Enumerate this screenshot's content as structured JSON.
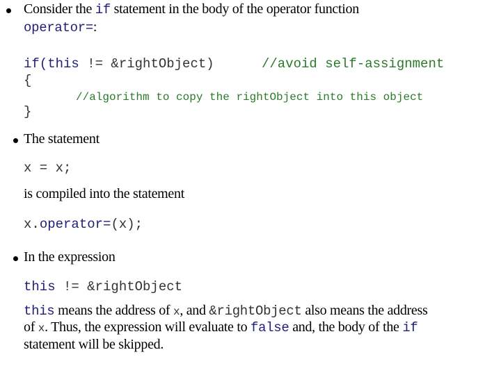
{
  "bullets": [
    {
      "intro_prefix": "Consider the ",
      "intro_kw": "if",
      "intro_suffix": " statement in the body of the operator function",
      "intro_line2_kw": "operator=",
      "intro_line2_suffix": ":",
      "code": {
        "line1_kw": "if(this",
        "line1_rest": " != &rightObject)",
        "line1_comment": "//avoid self-assignment",
        "open_brace": "{",
        "body_comment": "//algorithm to copy the rightObject into this object",
        "close_brace": "}"
      }
    },
    {
      "intro": "The statement",
      "code1": "x = x;",
      "middle": "is compiled into the statement",
      "code2_prefix": "x.",
      "code2_kw": "operator=",
      "code2_suffix": "(x);"
    },
    {
      "intro": "In the expression",
      "code_kw": "this",
      "code_rest": " != &rightObject",
      "explain": {
        "l1_kw": "this",
        "l1_a": " means the address of ",
        "l1_x": "x",
        "l1_b": ", and ",
        "l1_ref": "&rightObject",
        "l1_c": " also means the address",
        "l2_a": "of ",
        "l2_x": "x",
        "l2_b": ". Thus, the expression will evaluate to ",
        "l2_false": "false",
        "l2_c": " and, the body of the ",
        "l2_if": "if",
        "l3": "statement will be skipped."
      }
    }
  ],
  "colors": {
    "keyword": "#1f1f7a",
    "identifier": "#333333",
    "comment": "#2a7a2a"
  }
}
